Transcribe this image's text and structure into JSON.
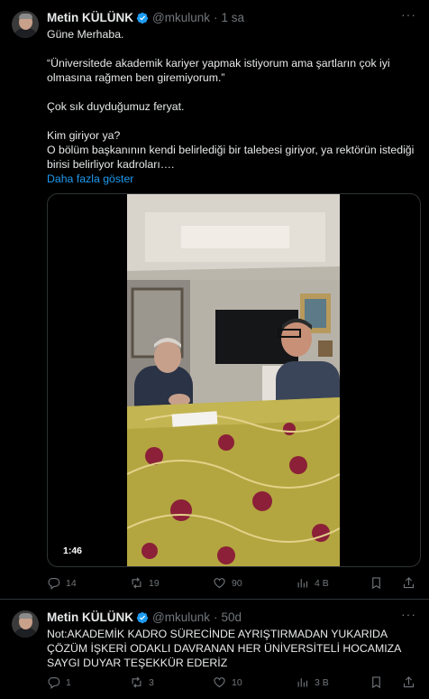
{
  "tweets": [
    {
      "name": "Metin KÜLÜNK",
      "handle": "@mkulunk",
      "sep": "·",
      "time": "1 sa",
      "lines": [
        "Güne Merhaba.",
        "“Üniversitede akademik kariyer yapmak istiyorum ama şartların çok iyi olmasına rağmen ben giremiyorum.”",
        "Çok sık duyduğumuz feryat.",
        "Kim giriyor ya?",
        "O bölüm başkanının kendi belirlediği bir talebesi giriyor, ya rektörün istediği birisi belirliyor kadroları…."
      ],
      "show_more": "Daha fazla göster",
      "video_duration": "1:46",
      "replies": "14",
      "reposts": "19",
      "likes": "90",
      "views": "4 B"
    },
    {
      "name": "Metin KÜLÜNK",
      "handle": "@mkulunk",
      "sep": "·",
      "time": "50d",
      "text": "Not:AKADEMİK KADRO SÜRECİNDE AYRIŞTIRMADAN YUKARIDA ÇÖZÜM İŞKERİ ODAKLI DAVRANAN HER ÜNİVERSİTELİ HOCAMIZA SAYGI DUYAR TEŞEKKÜR EDERİZ",
      "replies": "1",
      "reposts": "3",
      "likes": "10",
      "views": "3 B"
    }
  ],
  "colors": {
    "accent": "#1d9bf0",
    "muted": "#71767b",
    "text": "#e7e9ea",
    "background": "#000000"
  },
  "icons": [
    "verified-badge-icon",
    "more-icon",
    "reply-icon",
    "repost-icon",
    "like-icon",
    "views-icon",
    "bookmark-icon",
    "share-icon"
  ]
}
